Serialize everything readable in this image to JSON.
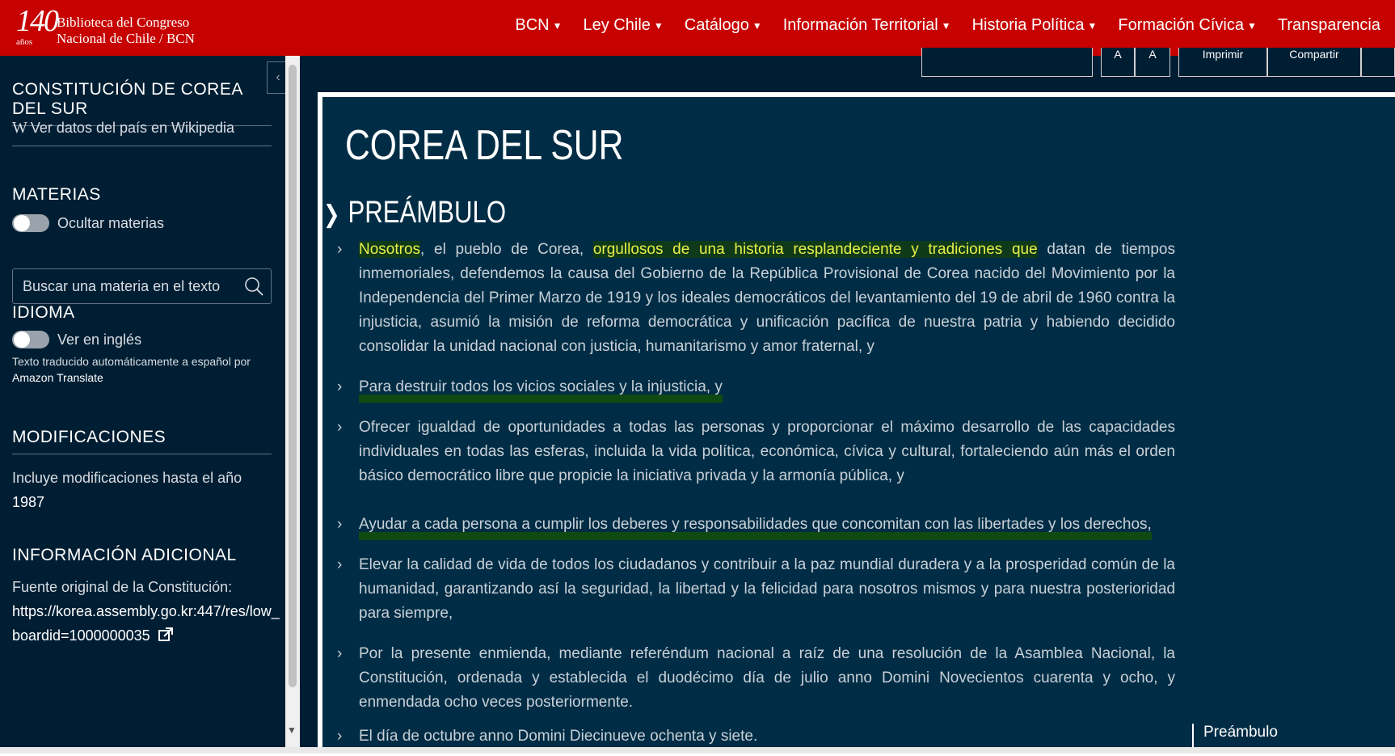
{
  "header": {
    "logo_number": "140",
    "logo_years": "años",
    "logo_line1": "Biblioteca del Congreso",
    "logo_line2": "Nacional de Chile / BCN",
    "nav": [
      {
        "label": "BCN",
        "dropdown": true
      },
      {
        "label": "Ley Chile",
        "dropdown": true
      },
      {
        "label": "Catálogo",
        "dropdown": true
      },
      {
        "label": "Información Territorial",
        "dropdown": true
      },
      {
        "label": "Historia Política",
        "dropdown": true
      },
      {
        "label": "Formación Cívica",
        "dropdown": true
      },
      {
        "label": "Transparencia",
        "dropdown": false
      }
    ]
  },
  "sidebar": {
    "title": "CONSTITUCIÓN DE COREA DEL SUR",
    "wiki_link": "Ver datos del país en Wikipedia",
    "materias_title": "MATERIAS",
    "hide_materias": "Ocultar materias",
    "search_placeholder": "Buscar una materia en el texto",
    "idioma_title": "IDIOMA",
    "english_toggle": "Ver en inglés",
    "translate_note": "Texto traducido automáticamente a español por",
    "translate_service": "Amazon Translate",
    "modificaciones_title": "MODIFICACIONES",
    "modificaciones_text": "Incluye modificaciones hasta el año",
    "modificaciones_year": "1987",
    "info_title": "INFORMACIÓN ADICIONAL",
    "info_source_label": "Fuente original de la Constitución:",
    "info_url_line1": "https://korea.assembly.go.kr:447/res/low_",
    "info_url_line2": "boardid=1000000035"
  },
  "toolbar": {
    "print": "Imprimir",
    "share": "Compartir"
  },
  "main": {
    "country_title": "COREA DEL SUR",
    "section_title": "PREÁMBULO",
    "paragraphs": [
      {
        "hl1": "Nosotros",
        "t1": ", el pueblo de Corea, ",
        "hl2": "orgullosos de una historia resplandeciente y tradiciones que",
        "t2": " datan de tiempos inmemoriales, defendemos la causa del Gobierno de la República Provisional de Corea nacido del Movimiento por la Independencia del Primer Marzo de 1919 y los ideales democráticos del levantamiento del 19 de abril de 1960 contra la injusticia, asumió la misión de reforma democrática y unificación pacífica de nuestra patria y habiendo decidido consolidar la unidad nacional con justicia, humanitarismo y amor fraternal, y"
      },
      {
        "text": "Para destruir todos los vicios sociales y la injusticia, y"
      },
      {
        "text": "Ofrecer igualdad de oportunidades a todas las personas y proporcionar el máximo desarrollo de las capacidades individuales en todas las esferas, incluida la vida política, económica, cívica y cultural, fortaleciendo aún más el orden básico democrático libre que propicie la iniciativa privada y la armonía pública, y"
      },
      {
        "text": "Ayudar a cada persona a cumplir los deberes y responsabilidades que concomitan con las libertades y los derechos,"
      },
      {
        "text": "Elevar la calidad de vida de todos los ciudadanos y contribuir a la paz mundial duradera y a la prosperidad común de la humanidad, garantizando así la seguridad, la libertad y la felicidad para nosotros mismos y para nuestra posterioridad para siempre,"
      },
      {
        "text": "Por la presente enmienda, mediante referéndum nacional a raíz de una resolución de la Asamblea Nacional, la Constitución, ordenada y establecida el duodécimo día de julio anno Domini Novecientos cuarenta y ocho, y enmendada ocho veces posteriormente."
      },
      {
        "text": "El día de octubre anno Domini Diecinueve ochenta y siete."
      }
    ],
    "toc_item": "Preámbulo"
  }
}
